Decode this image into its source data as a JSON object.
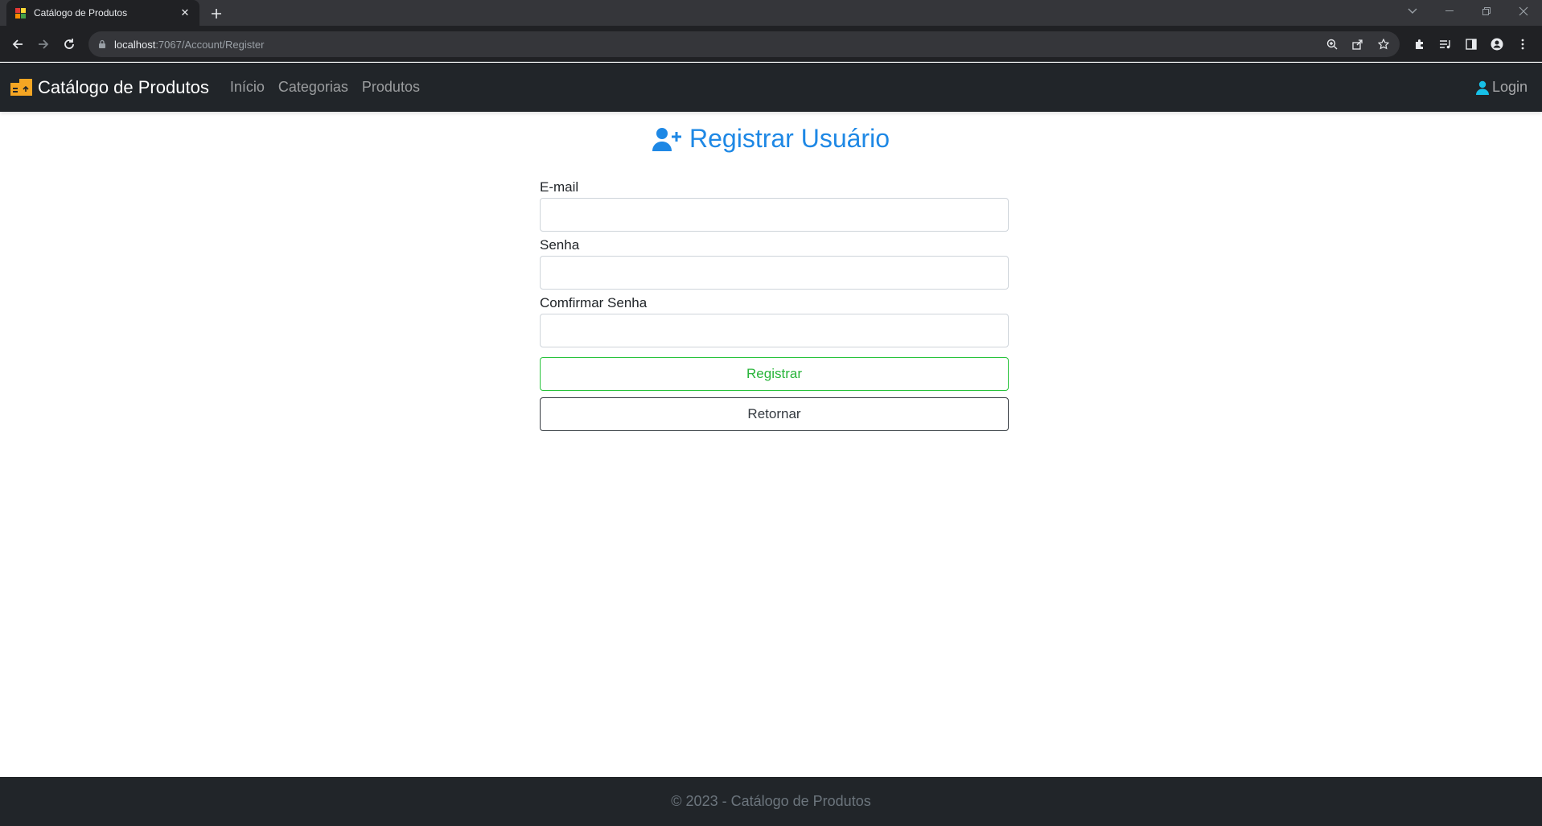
{
  "browser": {
    "tab_title": "Catálogo de Produtos",
    "url_host": "localhost",
    "url_path": ":7067/Account/Register"
  },
  "navbar": {
    "brand": "Catálogo de Produtos",
    "links": [
      "Início",
      "Categorias",
      "Produtos"
    ],
    "login": "Login"
  },
  "page": {
    "title": "Registrar Usuário",
    "email_label": "E-mail",
    "password_label": "Senha",
    "confirm_label": "Comfirmar Senha",
    "register_button": "Registrar",
    "return_button": "Retornar"
  },
  "footer": {
    "text": "© 2023 - Catálogo de Produtos"
  },
  "colors": {
    "navbar_bg": "#212529",
    "title": "#1e88e5",
    "register": "#28b43a",
    "login_icon": "#17c1e8",
    "brand_icon": "#f5a623"
  }
}
